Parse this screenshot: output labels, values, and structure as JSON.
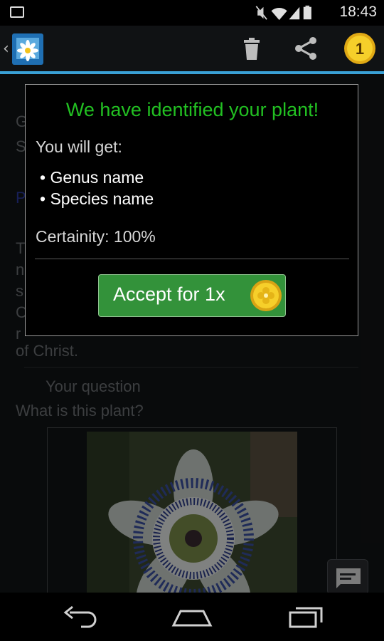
{
  "status_bar": {
    "time": "18:43"
  },
  "dialog": {
    "title": "We have identified your plant!",
    "subtitle": "You will get:",
    "items": [
      "Genus name",
      "Species name"
    ],
    "certainty": "Certainity: 100%",
    "accept_label": "Accept for 1x"
  },
  "action_bar": {
    "coin_count": "1"
  },
  "background": {
    "question_label": "Your question",
    "question_text": "What is this plant?",
    "tail_text": "of Christ."
  },
  "colors": {
    "accent": "#3aa1d6",
    "title_green": "#22c022",
    "button_green": "#33923a",
    "coin_gold": "#f2c21b"
  }
}
